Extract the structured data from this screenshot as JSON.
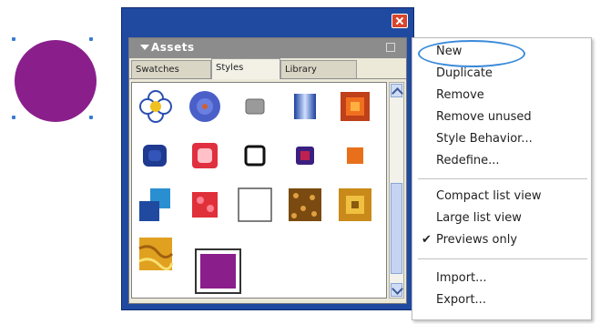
{
  "panel": {
    "title": "Assets",
    "tabs": [
      {
        "label": "Swatches",
        "active": false
      },
      {
        "label": "Styles",
        "active": true
      },
      {
        "label": "Library",
        "active": false
      }
    ],
    "frame_color": "#1f4aa0",
    "selected_swatch_color": "#8a1f8c"
  },
  "canvas": {
    "object_color": "#8a1f8c"
  },
  "context_menu": {
    "items": [
      {
        "label": "New",
        "highlighted": true
      },
      {
        "label": "Duplicate"
      },
      {
        "label": "Remove"
      },
      {
        "label": "Remove unused"
      },
      {
        "label": "Style Behavior..."
      },
      {
        "label": "Redefine..."
      },
      {
        "label": "Compact list view"
      },
      {
        "label": "Large list view"
      },
      {
        "label": "Previews only",
        "checked": true
      },
      {
        "label": "Import..."
      },
      {
        "label": "Export..."
      }
    ],
    "check_mark": "✔"
  }
}
